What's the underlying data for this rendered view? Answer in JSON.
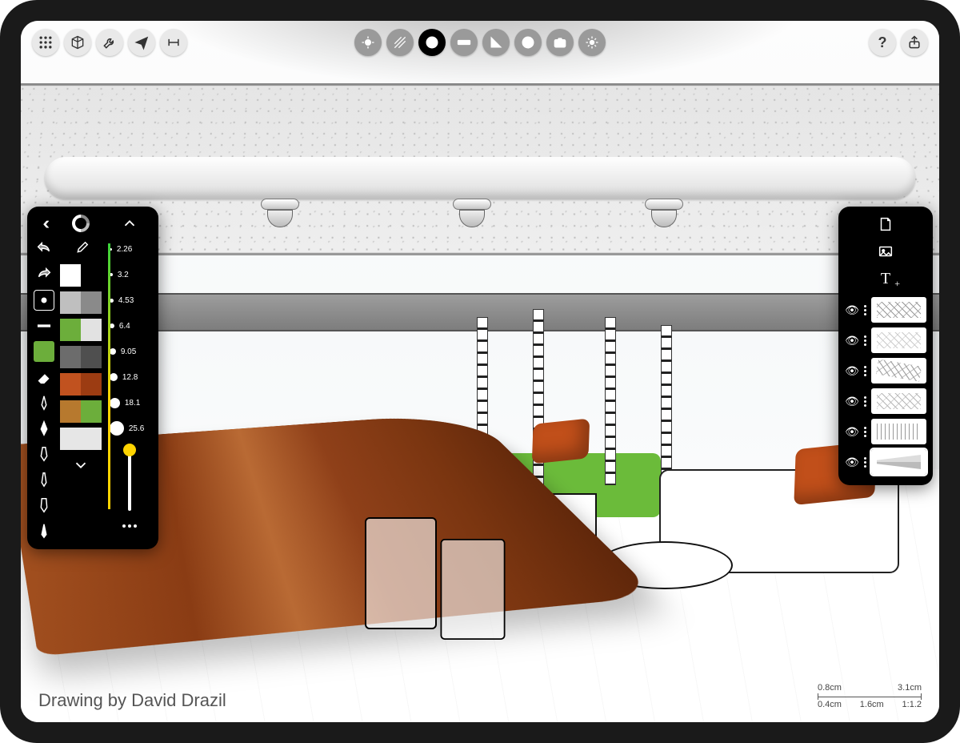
{
  "toolbar": {
    "left": [
      {
        "name": "grid-icon"
      },
      {
        "name": "cube-icon"
      },
      {
        "name": "wrench-icon"
      },
      {
        "name": "send-to-icon"
      },
      {
        "name": "measure-tool-icon"
      }
    ],
    "center": [
      {
        "name": "move-3d-icon",
        "style": "dark"
      },
      {
        "name": "hatch-icon",
        "style": "dark"
      },
      {
        "name": "clock-icon",
        "style": "black",
        "active": true
      },
      {
        "name": "ruler-icon",
        "style": "dark"
      },
      {
        "name": "set-square-icon",
        "style": "dark"
      },
      {
        "name": "no-entry-icon",
        "style": "dark"
      },
      {
        "name": "camera-icon",
        "style": "dark"
      },
      {
        "name": "gear-icon",
        "style": "dark"
      }
    ],
    "right": [
      {
        "name": "help-icon",
        "glyph": "?"
      },
      {
        "name": "share-icon"
      }
    ]
  },
  "left_panel": {
    "collapse_button": "collapse-palette",
    "color_wheel": "color-wheel",
    "undo": "undo-icon",
    "redo": "redo-icon",
    "eyedropper": "eyedropper-icon",
    "scroll_up": "chevron-up-icon",
    "scroll_down": "chevron-down-icon",
    "more": "more-icon",
    "tools": [
      {
        "name": "brush-preset-dot",
        "active": true
      },
      {
        "name": "brush-preset-line"
      },
      {
        "name": "fill-bucket-icon"
      },
      {
        "name": "eraser-icon"
      },
      {
        "name": "pen-fine-icon"
      },
      {
        "name": "pen-brush-icon"
      },
      {
        "name": "pen-marker-icon"
      },
      {
        "name": "pen-technical-icon"
      },
      {
        "name": "pen-air-icon"
      },
      {
        "name": "pen-ink-icon"
      }
    ],
    "swatches": [
      [
        "#ffffff",
        "#000000"
      ],
      [
        "#bfbfbf",
        "#8a8a8a"
      ],
      [
        "#6cae3b",
        "#e2e2e2"
      ],
      [
        "#6c6c6c",
        "#4f4f4f"
      ],
      [
        "#c1521f",
        "#9c3c12"
      ],
      [
        "#b7792e",
        "#6cae3b"
      ],
      [
        "#e6e6e6",
        "#e6e6e6"
      ]
    ],
    "brush_sizes": [
      2.26,
      3.2,
      4.53,
      6.4,
      9.05,
      12.8,
      18.1,
      25.6
    ],
    "selected_size": 25.6
  },
  "right_panel": {
    "add_layer": "new-layer-icon",
    "add_image": "image-layer-icon",
    "add_text": "text-layer-icon",
    "add_text_glyph": "T",
    "layers": [
      {
        "name": "layer-6",
        "visible": true
      },
      {
        "name": "layer-5",
        "visible": true
      },
      {
        "name": "layer-4",
        "visible": true
      },
      {
        "name": "layer-3",
        "visible": true
      },
      {
        "name": "layer-2",
        "visible": true
      },
      {
        "name": "layer-1-perspective",
        "visible": true,
        "selected": true
      }
    ]
  },
  "canvas": {
    "credit": "Drawing by David Drazil"
  },
  "scale": {
    "top_left": "0.8cm",
    "top_right": "3.1cm",
    "bottom_left": "0.4cm",
    "bottom_mid": "1.6cm",
    "ratio": "1:1.2"
  }
}
